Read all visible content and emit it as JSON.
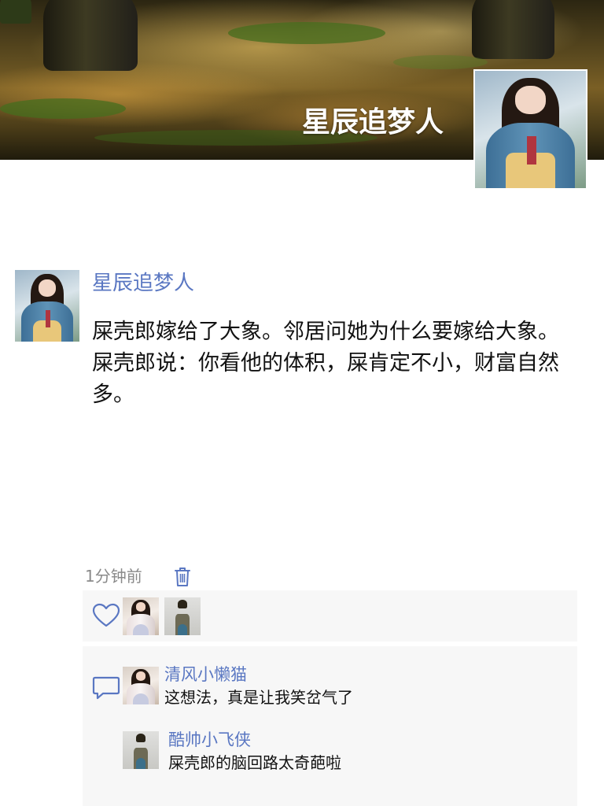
{
  "cover": {
    "display_name": "星辰追梦人"
  },
  "post": {
    "author": "星辰追梦人",
    "text": "屎壳郎嫁给了大象。邻居问她为什么要嫁给大象。屎壳郎说：你看他的体积，屎肯定不小，财富自然多。",
    "time": "1分钟前"
  },
  "comments": [
    {
      "author": "清风小懒猫",
      "text": "这想法，真是让我笑岔气了"
    },
    {
      "author": "酷帅小飞侠",
      "text": "屎壳郎的脑回路太奇葩啦"
    }
  ],
  "colors": {
    "name_link": "#5a77c2",
    "panel_bg": "#f7f7f7",
    "time_text": "#8a8a8a"
  },
  "icons": {
    "delete": "trash-icon",
    "like": "heart-icon",
    "comment": "comment-bubble-icon"
  }
}
